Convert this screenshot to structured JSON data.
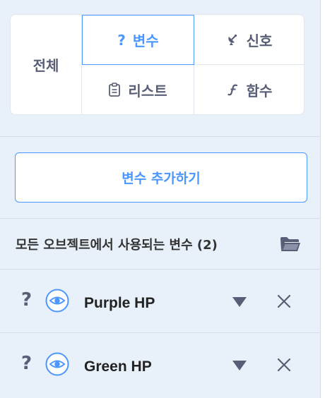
{
  "categories": {
    "all_label": "전체",
    "tabs": [
      {
        "label": "변수",
        "icon": "question-icon",
        "selected": true
      },
      {
        "label": "신호",
        "icon": "satellite-dish-icon",
        "selected": false
      },
      {
        "label": "리스트",
        "icon": "clipboard-icon",
        "selected": false
      },
      {
        "label": "함수",
        "icon": "function-icon",
        "selected": false
      }
    ],
    "question_glyph": "?"
  },
  "add_button": {
    "label": "변수 추가하기"
  },
  "section": {
    "title": "모든 오브젝트에서 사용되는 변수 (2)"
  },
  "variables": [
    {
      "name": "Purple HP",
      "type_glyph": "?"
    },
    {
      "name": "Green HP",
      "type_glyph": "?"
    }
  ],
  "colors": {
    "accent": "#4c97ff",
    "text": "#575e75",
    "background": "#e8f0f9"
  }
}
